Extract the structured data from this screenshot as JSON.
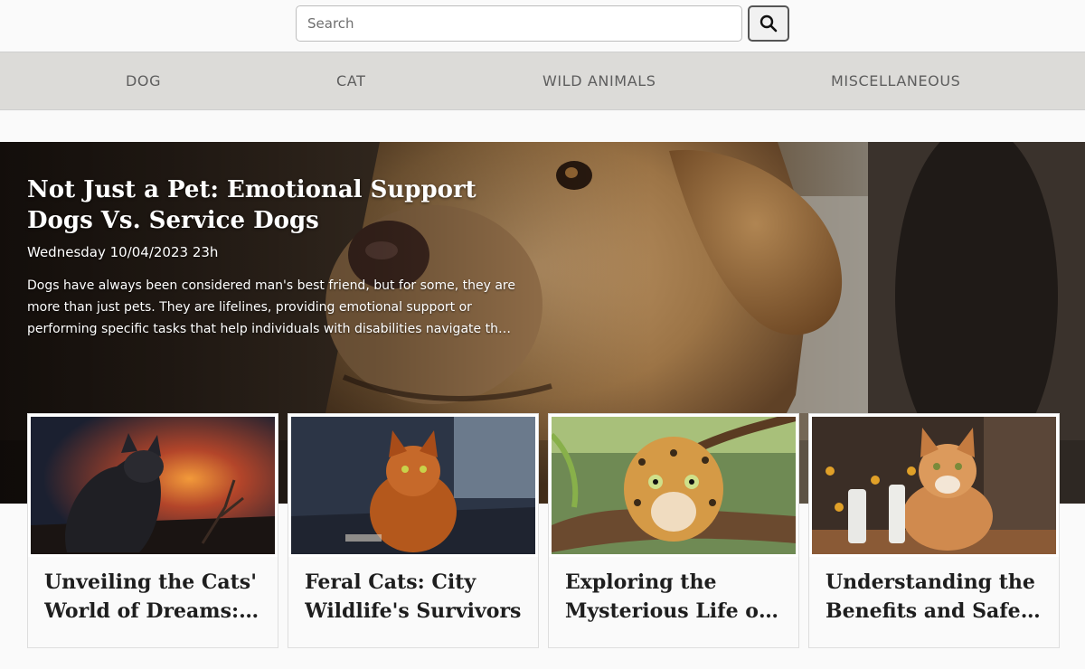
{
  "search": {
    "placeholder": "Search",
    "value": "",
    "button_icon": "search-icon"
  },
  "nav": {
    "items": [
      {
        "label": "DOG"
      },
      {
        "label": "CAT"
      },
      {
        "label": "WILD ANIMALS"
      },
      {
        "label": "MISCELLANEOUS"
      }
    ]
  },
  "hero": {
    "title": "Not Just a Pet: Emotional Support Dogs Vs. Service Dogs",
    "date": "Wednesday 10/04/2023 23h",
    "excerpt": "Dogs have always been considered man's best friend, but for some, they are more than just pets. They are lifelines, providing emotional support or performing specific tasks that help individuals with disabilities navigate their daily lives.",
    "image": "dog-closeup-photo"
  },
  "cards": [
    {
      "title": "Unveiling the Cats' World of Dreams: A Journey",
      "image": "black-cat-sunset-photo"
    },
    {
      "title": "Feral Cats: City Wildlife's Survivors",
      "image": "orange-feral-cat-photo"
    },
    {
      "title": "Exploring the Mysterious Life of Jaguars",
      "image": "jaguar-in-tree-photo"
    },
    {
      "title": "Understanding the Benefits and Safety of Products",
      "image": "ginger-cat-products-photo"
    }
  ],
  "colors": {
    "nav_bg": "#dcdbd8",
    "page_bg": "#fafafa",
    "nav_text": "#5e5e5e",
    "card_title": "#1e1e1e"
  }
}
